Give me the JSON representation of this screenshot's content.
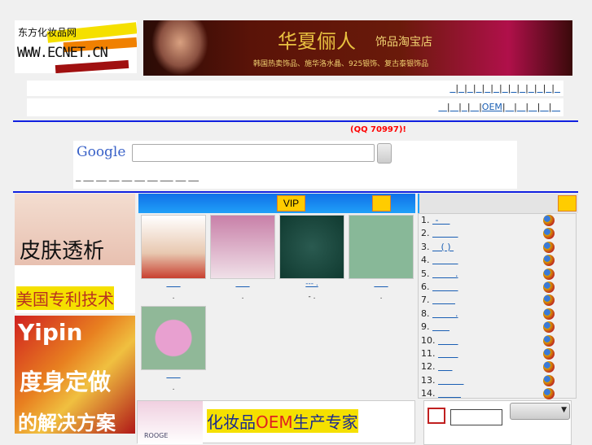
{
  "logo": {
    "title": "东方化妆品网",
    "url": "WWW.ECNET.CN"
  },
  "banner": {
    "title": "华夏俪人",
    "subtitle": "饰品淘宝店",
    "tagline": "韩国热卖饰品、施华洛水晶、925银饰、复古泰银饰品"
  },
  "nav1": [
    "  ",
    "  ",
    "  ",
    "  ",
    "  ",
    "  ",
    "  ",
    "  ",
    "  ",
    "  ",
    "  ",
    "  ",
    "  "
  ],
  "nav2": [
    "   ",
    "   ",
    "  ",
    "   ",
    "OEM",
    "   ",
    "   ",
    "   ",
    "   ",
    "   "
  ],
  "notice": "(QQ 70997)!",
  "search": {
    "logo": "Google",
    "value": "",
    "button": " ",
    "links": [
      "  ",
      "    ",
      "    ",
      "    ",
      "    ",
      "    ",
      "    ",
      "     ",
      "    ",
      "    "
    ]
  },
  "left_ads": [
    {
      "text": "皮肤透析",
      "sub": "美国专利技术"
    },
    {
      "text": "Yipin",
      "sub": "度身定做",
      "sub2": "的解决方案"
    }
  ],
  "vip": {
    "button": "VIP",
    "more": " ",
    "products": [
      {
        "link": "      ",
        "note": "."
      },
      {
        "link": "      ",
        "note": "."
      },
      {
        "link": "--- .",
        "note": "- ."
      },
      {
        "link": "      ",
        "note": "."
      },
      {
        "link": "      ",
        "note": "."
      }
    ]
  },
  "ranking": {
    "more": " ",
    "items": [
      {
        "n": "1.",
        "t": " -    "
      },
      {
        "n": "2.",
        "t": "         "
      },
      {
        "n": "3.",
        "t": "   ( ) "
      },
      {
        "n": "4.",
        "t": "         "
      },
      {
        "n": "5.",
        "t": "        ."
      },
      {
        "n": "6.",
        "t": "         "
      },
      {
        "n": "7.",
        "t": "        "
      },
      {
        "n": "8.",
        "t": "        ."
      },
      {
        "n": "9.",
        "t": "      "
      },
      {
        "n": "10.",
        "t": "       "
      },
      {
        "n": "11.",
        "t": "       "
      },
      {
        "n": "12.",
        "t": "     "
      },
      {
        "n": "13.",
        "t": "         "
      },
      {
        "n": "14.",
        "t": "        "
      }
    ]
  },
  "oem_banner": {
    "brand": "ROOGE",
    "text": "化妆品",
    "oem": "OEM",
    "text2": "生产专家"
  },
  "bottom_form": {
    "input": "",
    "select": ""
  }
}
